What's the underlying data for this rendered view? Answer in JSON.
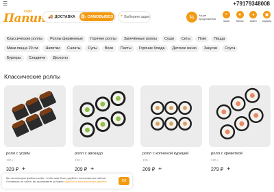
{
  "topbar": {
    "menu_icon": "hamburger-icon",
    "phone": "+79179348008"
  },
  "header": {
    "logo_cafe": "кафе",
    "logo_name": "Папино",
    "delivery_label": "ДОСТАВКА",
    "pickup_label": "САМОВЫВОЗ",
    "address_placeholder": "Выберите адрес",
    "promo_text_1": "Акции",
    "promo_text_2": "предложения",
    "nav": [
      {
        "label": "поиск",
        "icon": "search-icon"
      },
      {
        "label": "баллы",
        "icon": "points-icon"
      },
      {
        "label": "войти",
        "icon": "user-icon"
      },
      {
        "label": "корзина",
        "icon": "cart-icon"
      }
    ]
  },
  "categories": [
    [
      "Классические роллы",
      "Роллы фирменные",
      "Горячие роллы",
      "Запечённые роллы",
      "Суши",
      "Сеты",
      "Поке",
      "Пицца"
    ],
    [
      "Мини пицца 20 см",
      "Напитки",
      "Салаты",
      "Супы",
      "Воки",
      "Пасты",
      "Горячие блюда",
      "Детское меню",
      "Закуски",
      "Соуса"
    ],
    [
      "Бургеры",
      "Сэндвичи",
      "Десерты"
    ]
  ],
  "section_title": "Классические роллы",
  "products": [
    {
      "title": "ролл с угрём",
      "weight": "120 г",
      "price": "329 ₽"
    },
    {
      "title": "ролл с авокадо",
      "weight": "120 г",
      "price": "209 ₽"
    },
    {
      "title": "ролл с копченой курицей",
      "weight": "120 г",
      "price": "209 ₽"
    },
    {
      "title": "ролл с креветкой",
      "weight": "120 г",
      "price": "279 ₽"
    }
  ],
  "cookie": {
    "text": "Мы используем файлы cookie, чтобы вам было удобнее пользоваться сайтом. Оставаясь на сайте, вы принимаете условия ",
    "link": "обработки персональных данных",
    "ok": "ОК"
  },
  "colors": {
    "accent": "#f29a12",
    "chip_bg": "#f0f0f0"
  }
}
